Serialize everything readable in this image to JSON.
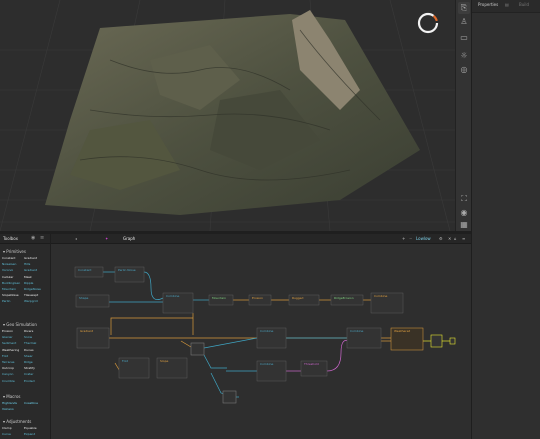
{
  "properties": {
    "tab_label": "Properties",
    "build_label": "Build"
  },
  "library": {
    "title": "Toolbox",
    "sections": [
      {
        "label": "Primitives",
        "items": [
          [
            "Constant",
            "Gradient"
          ],
          [
            "NoiseGen",
            "Hills"
          ],
          [
            "Voronoi",
            "Gradient"
          ],
          [
            "Cellular",
            "Mask"
          ],
          [
            "BuildingGen",
            "Ripple"
          ],
          [
            "Mountain",
            "RidgeNoise"
          ],
          [
            "SlopeNoise",
            "Tileswept"
          ],
          [
            "Perlin",
            "Warpgrid"
          ]
        ]
      },
      {
        "label": "Geo Simulation",
        "items": [
          [
            "Erosion",
            "Rivers"
          ],
          [
            "Glacier",
            "Snow"
          ],
          [
            "Sediment",
            "Thermal"
          ],
          [
            "Weathering",
            "Dunes"
          ],
          [
            "Fold",
            "Shear"
          ],
          [
            "Terraces",
            "Ridge"
          ],
          [
            "Outcrop",
            "Stratify"
          ],
          [
            "Canyon",
            "Crater"
          ],
          [
            "Crumble",
            "Eroded"
          ]
        ]
      },
      {
        "label": "Macros",
        "items": [
          [
            "Highlands",
            "Coastline"
          ],
          [
            "Volcano",
            ""
          ]
        ]
      },
      {
        "label": "Adjustments",
        "items": [
          [
            "Clamp",
            "Equalize"
          ],
          [
            "Curve",
            "Expand"
          ],
          [
            "Combine",
            "Invert"
          ]
        ]
      }
    ]
  },
  "graph": {
    "tabs": [
      "Graph"
    ],
    "right_label": "Lowlow",
    "nodes": [
      {
        "label": "Constant",
        "color": "#4aa3c0"
      },
      {
        "label": "Perlin Noise",
        "color": "#4aa3c0"
      },
      {
        "label": "Shape",
        "color": "#4aa3c0"
      },
      {
        "label": "Combine",
        "color": "#4aa3c0"
      },
      {
        "label": "Mountain",
        "color": "#7fcf7f"
      },
      {
        "label": "Erosion",
        "color": "#e0a040"
      },
      {
        "label": "Rugged",
        "color": "#e0a040"
      },
      {
        "label": "RidgeErosion",
        "color": "#7fcf7f"
      },
      {
        "label": "Combine",
        "color": "#e0a040"
      },
      {
        "label": "Gradient",
        "color": "#e0a040"
      },
      {
        "label": "Fold",
        "color": "#4aa3c0"
      },
      {
        "label": "Slope",
        "color": "#e0a040"
      },
      {
        "label": "Combine",
        "color": "#4aa3c0"
      },
      {
        "label": "Combine",
        "color": "#4aa3c0"
      },
      {
        "label": "Combine",
        "color": "#4aa3c0"
      },
      {
        "label": "Threshold",
        "color": "#cc66cc"
      },
      {
        "label": "Weathered",
        "color": "#e0a040"
      }
    ]
  },
  "colors": {
    "accent": "#f2f2f2",
    "wire_orange": "#d99a3c",
    "wire_blue": "#3fa6c4",
    "wire_yellow": "#e6e630",
    "selected": "#e6e630"
  }
}
